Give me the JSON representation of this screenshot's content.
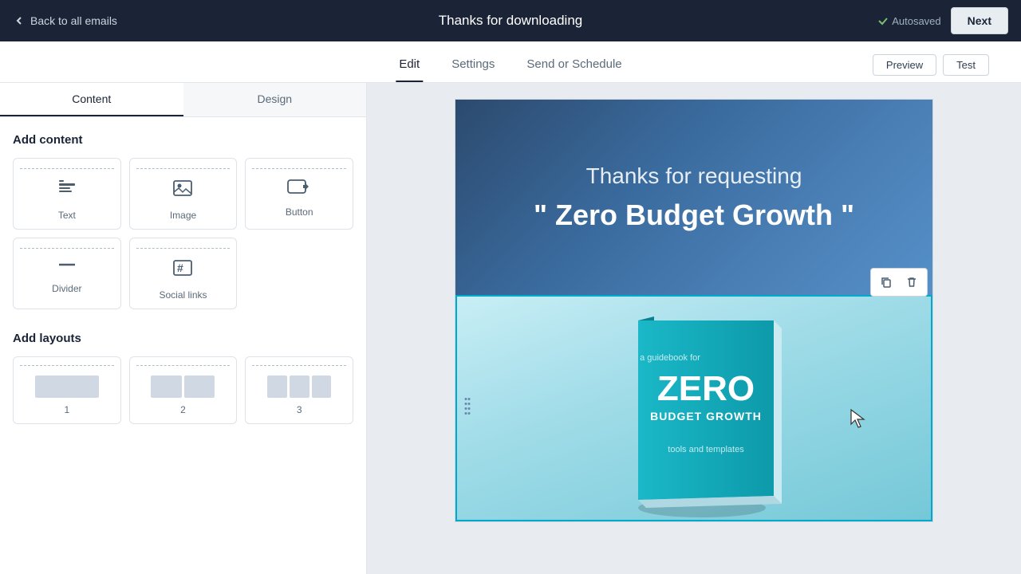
{
  "topBar": {
    "backLabel": "Back to all emails",
    "title": "Thanks for downloading",
    "autosaved": "Autosaved",
    "nextLabel": "Next"
  },
  "tabs": {
    "items": [
      {
        "id": "edit",
        "label": "Edit",
        "active": true
      },
      {
        "id": "settings",
        "label": "Settings",
        "active": false
      },
      {
        "id": "send-schedule",
        "label": "Send or Schedule",
        "active": false
      }
    ],
    "previewLabel": "Preview",
    "testLabel": "Test"
  },
  "sidebar": {
    "tabs": [
      {
        "id": "content",
        "label": "Content",
        "active": true
      },
      {
        "id": "design",
        "label": "Design",
        "active": false
      }
    ],
    "addContentTitle": "Add content",
    "contentItems": [
      {
        "id": "text",
        "label": "Text",
        "icon": "text-icon"
      },
      {
        "id": "image",
        "label": "Image",
        "icon": "image-icon"
      },
      {
        "id": "button",
        "label": "Button",
        "icon": "button-icon"
      },
      {
        "id": "divider",
        "label": "Divider",
        "icon": "divider-icon"
      },
      {
        "id": "social-links",
        "label": "Social links",
        "icon": "social-icon"
      }
    ],
    "addLayoutsTitle": "Add layouts",
    "layoutItems": [
      {
        "id": "1col",
        "label": "1",
        "cols": 1
      },
      {
        "id": "2col",
        "label": "2",
        "cols": 2
      },
      {
        "id": "3col",
        "label": "3",
        "cols": 3
      }
    ]
  },
  "email": {
    "headerLine1": "Thanks for requesting",
    "headerLine2": "\" Zero Budget Growth \"",
    "book": {
      "subtitle": "a guidebook for",
      "titleMain": "ZERO",
      "titleSub": "BUDGET GROWTH",
      "tagline": "tools and templates"
    }
  },
  "toolbar": {
    "duplicateTitle": "Duplicate",
    "deleteTitle": "Delete"
  }
}
